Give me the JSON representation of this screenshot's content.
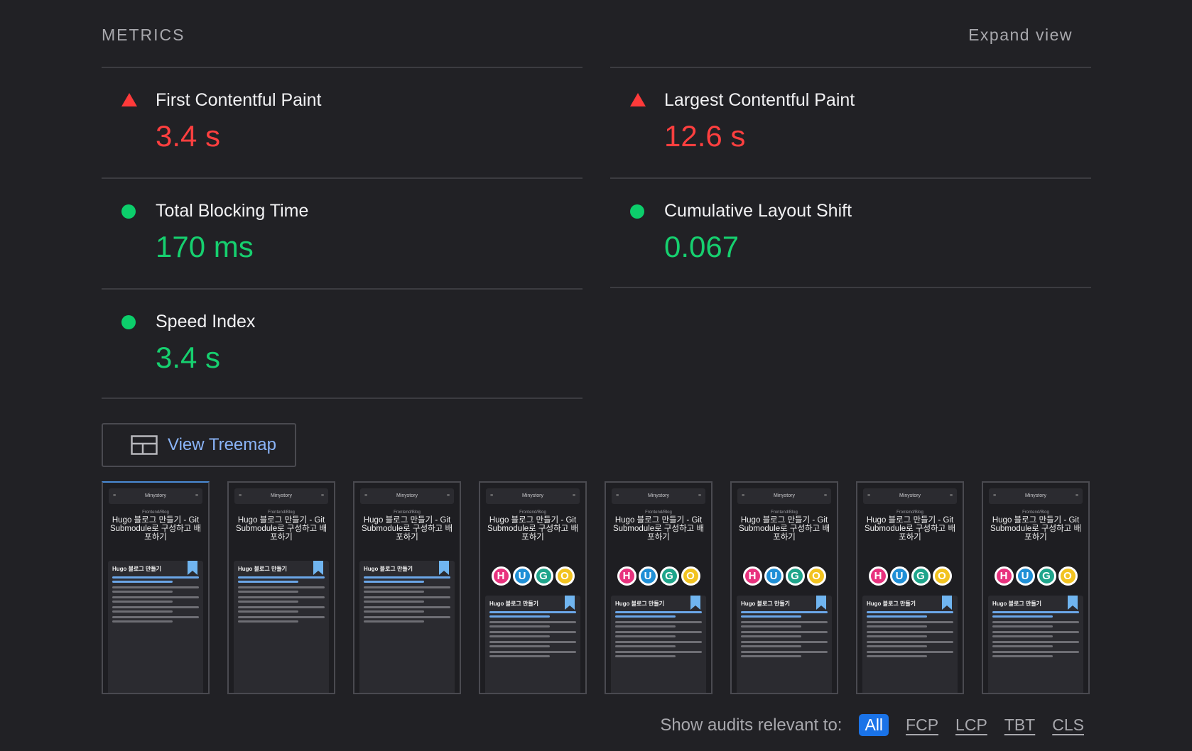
{
  "header": {
    "title": "METRICS",
    "expand_label": "Expand view"
  },
  "metrics": [
    {
      "label": "First Contentful Paint",
      "value": "3.4 s",
      "status": "fail"
    },
    {
      "label": "Largest Contentful Paint",
      "value": "12.6 s",
      "status": "fail"
    },
    {
      "label": "Total Blocking Time",
      "value": "170 ms",
      "status": "pass"
    },
    {
      "label": "Cumulative Layout Shift",
      "value": "0.067",
      "status": "pass"
    },
    {
      "label": "Speed Index",
      "value": "3.4 s",
      "status": "pass"
    }
  ],
  "treemap": {
    "label": "View Treemap",
    "icon": "treemap-icon"
  },
  "filmstrip": {
    "frames": [
      {
        "site": "Minystory",
        "crumb": "Frontend/Blog",
        "title": "Hugo 블로그 만들기 - Git Submodule로 구성하고 배포하기",
        "toc": "Hugo 블로그 만들기",
        "logo": false
      },
      {
        "site": "Minystory",
        "crumb": "Frontend/Blog",
        "title": "Hugo 블로그 만들기 - Git Submodule로 구성하고 배포하기",
        "toc": "Hugo 블로그 만들기",
        "logo": false
      },
      {
        "site": "Minystory",
        "crumb": "Frontend/Blog",
        "title": "Hugo 블로그 만들기 - Git Submodule로 구성하고 배포하기",
        "toc": "Hugo 블로그 만들기",
        "logo": false
      },
      {
        "site": "Minystory",
        "crumb": "Frontend/Blog",
        "title": "Hugo 블로그 만들기 - Git Submodule로 구성하고 배포하기",
        "toc": "Hugo 블로그 만들기",
        "logo": true
      },
      {
        "site": "Minystory",
        "crumb": "Frontend/Blog",
        "title": "Hugo 블로그 만들기 - Git Submodule로 구성하고 배포하기",
        "toc": "Hugo 블로그 만들기",
        "logo": true
      },
      {
        "site": "Minystory",
        "crumb": "Frontend/Blog",
        "title": "Hugo 블로그 만들기 - Git Submodule로 구성하고 배포하기",
        "toc": "Hugo 블로그 만들기",
        "logo": true
      },
      {
        "site": "Minystory",
        "crumb": "Frontend/Blog",
        "title": "Hugo 블로그 만들기 - Git Submodule로 구성하고 배포하기",
        "toc": "Hugo 블로그 만들기",
        "logo": true
      },
      {
        "site": "Minystory",
        "crumb": "Frontend/Blog",
        "title": "Hugo 블로그 만들기 - Git Submodule로 구성하고 배포하기",
        "toc": "Hugo 블로그 만들기",
        "logo": true
      }
    ],
    "logo_letters": [
      "H",
      "U",
      "G",
      "O"
    ],
    "logo_colors": [
      "#e8327e",
      "#1f8fd6",
      "#1fa58b",
      "#f2c320"
    ]
  },
  "audit_filter": {
    "label": "Show audits relevant to:",
    "chips": [
      {
        "label": "All",
        "active": true
      },
      {
        "label": "FCP",
        "active": false
      },
      {
        "label": "LCP",
        "active": false
      },
      {
        "label": "TBT",
        "active": false
      },
      {
        "label": "CLS",
        "active": false
      }
    ]
  },
  "colors": {
    "fail": "#ff3f3f",
    "pass": "#16d06f",
    "accent": "#1a73e8",
    "link": "#8ab4f8"
  }
}
